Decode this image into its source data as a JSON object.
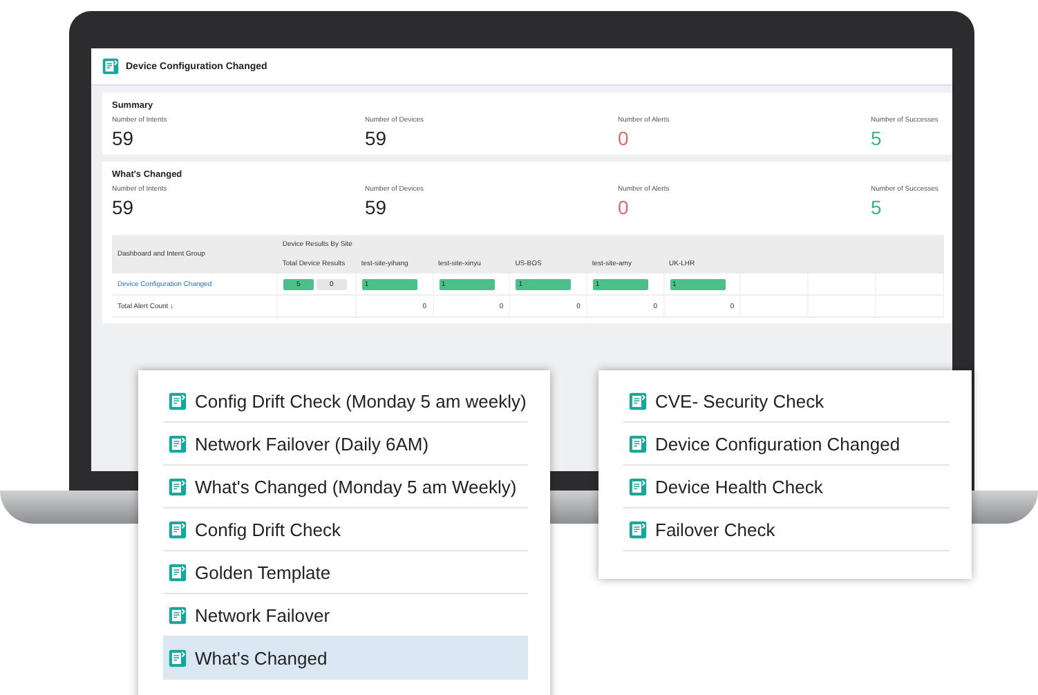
{
  "header": {
    "title": "Device Configuration Changed"
  },
  "sections": [
    {
      "title": "Summary",
      "stats": [
        {
          "label": "Number of Intents",
          "value": "59",
          "kind": "count"
        },
        {
          "label": "Number of Devices",
          "value": "59",
          "kind": "count"
        },
        {
          "label": "Number of Alerts",
          "value": "0",
          "kind": "alert"
        },
        {
          "label": "Number of Successes",
          "value": "5",
          "kind": "success"
        }
      ]
    },
    {
      "title": "What's Changed",
      "stats": [
        {
          "label": "Number of Intents",
          "value": "59",
          "kind": "count"
        },
        {
          "label": "Number of Devices",
          "value": "59",
          "kind": "count"
        },
        {
          "label": "Number of Alerts",
          "value": "0",
          "kind": "alert"
        },
        {
          "label": "Number of Successes",
          "value": "5",
          "kind": "success"
        }
      ]
    }
  ],
  "table": {
    "group_header": "Dashboard and Intent Group",
    "site_group": "Device Results By Site",
    "columns": [
      "Total Device Results",
      "test-site-yihang",
      "test-site-xinyu",
      "US-BOS",
      "test-site-amy",
      "UK-LHR"
    ],
    "result_row": {
      "name": "Device Configuration Changed",
      "total_success": "5",
      "total_fail": "0",
      "sites": [
        "1",
        "1",
        "1",
        "1",
        "1"
      ]
    },
    "alert_row": {
      "name": "Total Alert Count ↓",
      "sites": [
        "0",
        "0",
        "0",
        "0",
        "0"
      ]
    }
  },
  "left_menu": [
    {
      "label": "Config Drift Check (Monday 5 am weekly)",
      "selected": false
    },
    {
      "label": "Network Failover (Daily 6AM)",
      "selected": false
    },
    {
      "label": "What's Changed (Monday 5 am Weekly)",
      "selected": false
    },
    {
      "label": "Config Drift Check",
      "selected": false
    },
    {
      "label": "Golden Template",
      "selected": false
    },
    {
      "label": "Network Failover",
      "selected": false
    },
    {
      "label": "What's Changed",
      "selected": true
    }
  ],
  "right_menu": [
    {
      "label": "CVE- Security Check",
      "selected": false
    },
    {
      "label": "Device Configuration Changed",
      "selected": false
    },
    {
      "label": "Device Health Check",
      "selected": false
    },
    {
      "label": "Failover Check",
      "selected": false
    }
  ]
}
